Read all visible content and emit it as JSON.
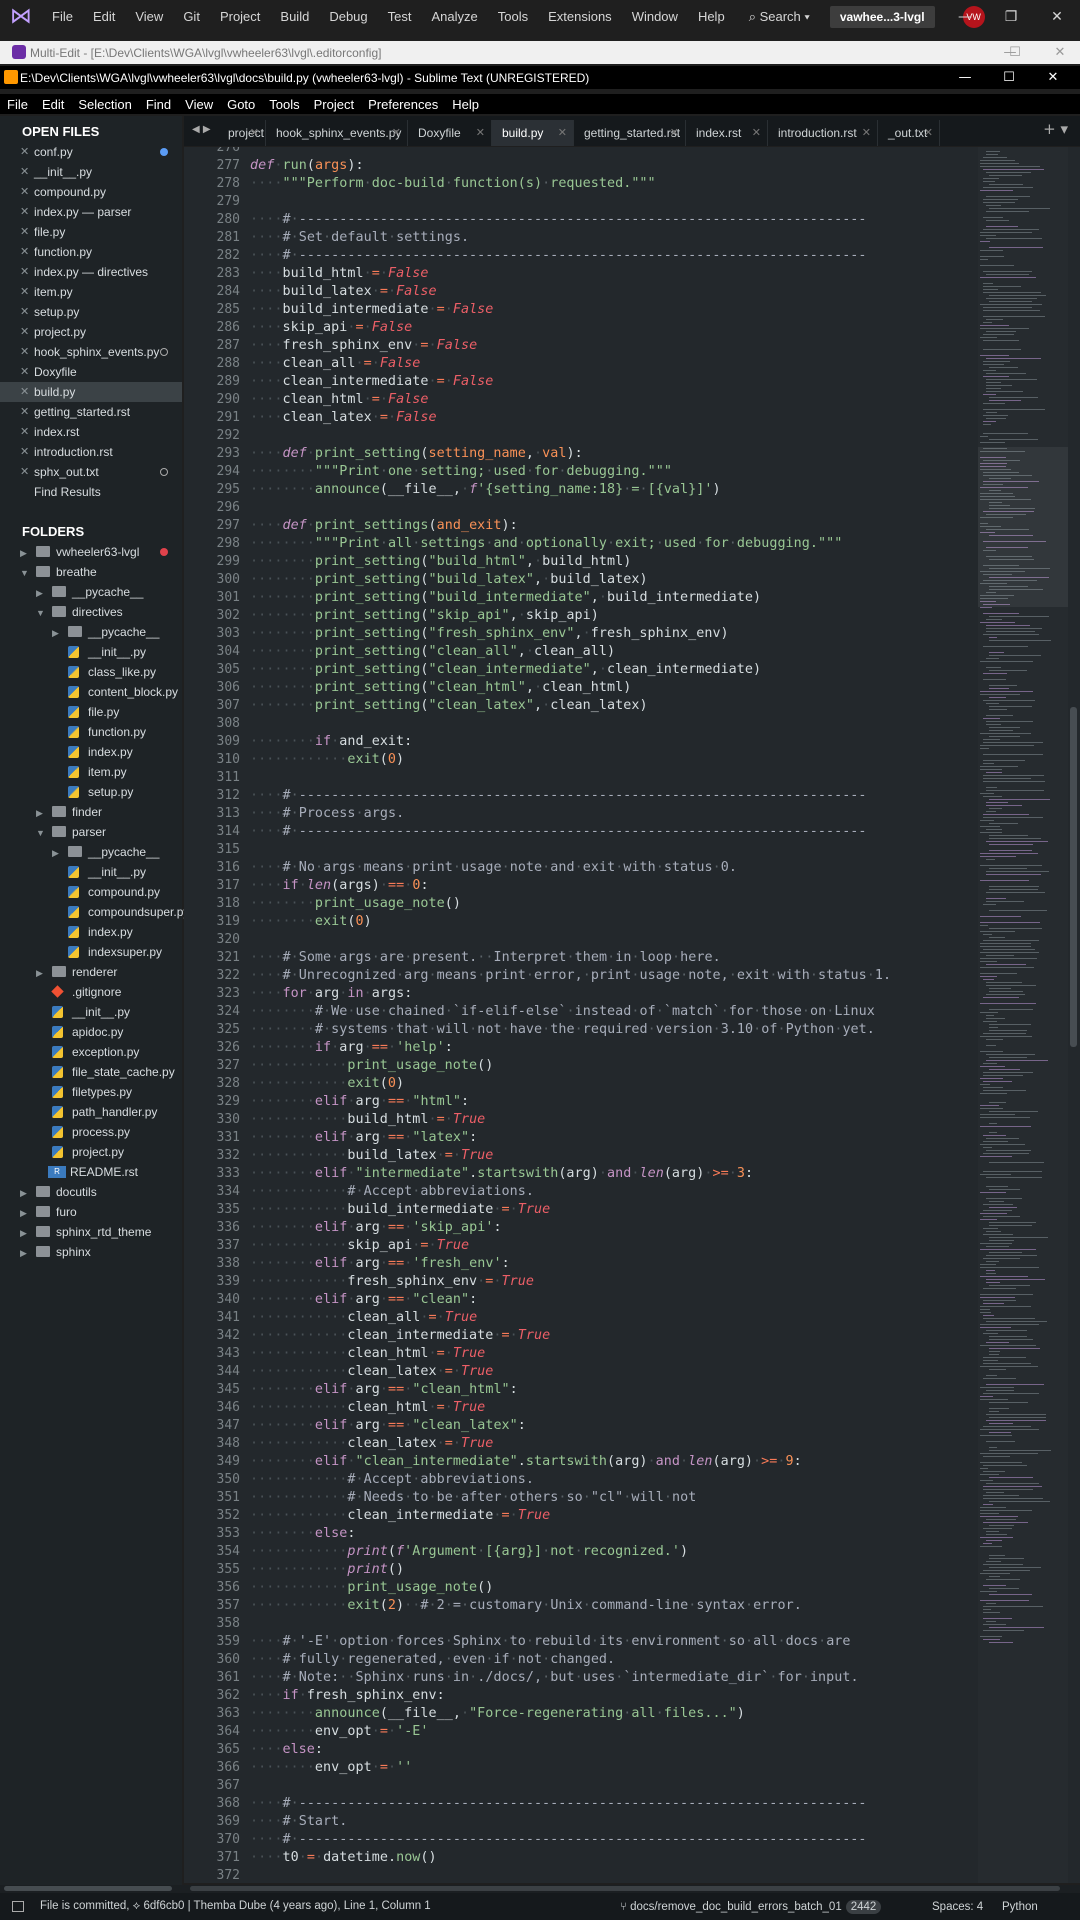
{
  "vs": {
    "menu": [
      "File",
      "Edit",
      "View",
      "Git",
      "Project",
      "Build",
      "Debug",
      "Test",
      "Analyze",
      "Tools",
      "Extensions",
      "Window",
      "Help"
    ],
    "search": "Search",
    "project": "vawhee...3-lvgl",
    "avatar": "VW"
  },
  "multiedit": {
    "title": "Multi-Edit - [E:\\Dev\\Clients\\WGA\\lvgl\\vwheeler63\\lvgl\\.editorconfig]"
  },
  "sublime": {
    "title": "E:\\Dev\\Clients\\WGA\\lvgl\\vwheeler63\\lvgl\\docs\\build.py (vwheeler63-lvgl) - Sublime Text (UNREGISTERED)",
    "menu": [
      "File",
      "Edit",
      "Selection",
      "Find",
      "View",
      "Goto",
      "Tools",
      "Project",
      "Preferences",
      "Help"
    ]
  },
  "sidebar": {
    "open_files_title": "OPEN FILES",
    "folders_title": "FOLDERS",
    "open_files": [
      "conf.py",
      "__init__.py",
      "compound.py",
      "index.py — parser",
      "file.py",
      "function.py",
      "index.py — directives",
      "item.py",
      "setup.py",
      "project.py",
      "hook_sphinx_events.py",
      "Doxyfile",
      "build.py",
      "getting_started.rst",
      "index.rst",
      "introduction.rst",
      "sphx_out.txt",
      "Find Results"
    ],
    "folders": [
      "vwheeler63-lvgl",
      "breathe",
      "__pycache__",
      "directives",
      "__pycache__",
      "__init__.py",
      "class_like.py",
      "content_block.py",
      "file.py",
      "function.py",
      "index.py",
      "item.py",
      "setup.py",
      "finder",
      "parser",
      "__pycache__",
      "__init__.py",
      "compound.py",
      "compoundsuper.py",
      "index.py",
      "indexsuper.py",
      "renderer",
      ".gitignore",
      "__init__.py",
      "apidoc.py",
      "exception.py",
      "file_state_cache.py",
      "filetypes.py",
      "path_handler.py",
      "process.py",
      "project.py",
      "README.rst",
      "docutils",
      "furo",
      "sphinx_rtd_theme",
      "sphinx"
    ]
  },
  "tabs": [
    "project.",
    "hook_sphinx_events.py",
    "Doxyfile",
    "build.py",
    "getting_started.rst",
    "index.rst",
    "introduction.rst",
    "_out.txt"
  ],
  "code": {
    "first_line": 276,
    "lines": [
      "",
      "def run(args):",
      "    \"\"\"Perform doc-build function(s) requested.\"\"\"",
      "",
      "    # ----------------------------------------------------------------------",
      "    # Set default settings.",
      "    # ----------------------------------------------------------------------",
      "    build_html = False",
      "    build_latex = False",
      "    build_intermediate = False",
      "    skip_api = False",
      "    fresh_sphinx_env = False",
      "    clean_all = False",
      "    clean_intermediate = False",
      "    clean_html = False",
      "    clean_latex = False",
      "",
      "    def print_setting(setting_name, val):",
      "        \"\"\"Print one setting; used for debugging.\"\"\"",
      "        announce(__file__, f'{setting_name:18} = [{val}]')",
      "",
      "    def print_settings(and_exit):",
      "        \"\"\"Print all settings and optionally exit; used for debugging.\"\"\"",
      "        print_setting(\"build_html\", build_html)",
      "        print_setting(\"build_latex\", build_latex)",
      "        print_setting(\"build_intermediate\", build_intermediate)",
      "        print_setting(\"skip_api\", skip_api)",
      "        print_setting(\"fresh_sphinx_env\", fresh_sphinx_env)",
      "        print_setting(\"clean_all\", clean_all)",
      "        print_setting(\"clean_intermediate\", clean_intermediate)",
      "        print_setting(\"clean_html\", clean_html)",
      "        print_setting(\"clean_latex\", clean_latex)",
      "",
      "        if and_exit:",
      "            exit(0)",
      "",
      "    # ----------------------------------------------------------------------",
      "    # Process args.",
      "    # ----------------------------------------------------------------------",
      "",
      "    # No args means print usage note and exit with status 0.",
      "    if len(args) == 0:",
      "        print_usage_note()",
      "        exit(0)",
      "",
      "    # Some args are present.  Interpret them in loop here.",
      "    # Unrecognized arg means print error, print usage note, exit with status 1.",
      "    for arg in args:",
      "        # We use chained `if-elif-else` instead of `match` for those on Linux",
      "        # systems that will not have the required version 3.10 of Python yet.",
      "        if arg == 'help':",
      "            print_usage_note()",
      "            exit(0)",
      "        elif arg == \"html\":",
      "            build_html = True",
      "        elif arg == \"latex\":",
      "            build_latex = True",
      "        elif \"intermediate\".startswith(arg) and len(arg) >= 3:",
      "            # Accept abbreviations.",
      "            build_intermediate = True",
      "        elif arg == 'skip_api':",
      "            skip_api = True",
      "        elif arg == 'fresh_env':",
      "            fresh_sphinx_env = True",
      "        elif arg == \"clean\":",
      "            clean_all = True",
      "            clean_intermediate = True",
      "            clean_html = True",
      "            clean_latex = True",
      "        elif arg == \"clean_html\":",
      "            clean_html = True",
      "        elif arg == \"clean_latex\":",
      "            clean_latex = True",
      "        elif \"clean_intermediate\".startswith(arg) and len(arg) >= 9:",
      "            # Accept abbreviations.",
      "            # Needs to be after others so \"cl\" will not",
      "            clean_intermediate = True",
      "        else:",
      "            print(f'Argument [{arg}] not recognized.')",
      "            print()",
      "            print_usage_note()",
      "            exit(2)  # 2 = customary Unix command-line syntax error.",
      "",
      "    # '-E' option forces Sphinx to rebuild its environment so all docs are",
      "    # fully regenerated, even if not changed.",
      "    # Note:  Sphinx runs in ./docs/, but uses `intermediate_dir` for input.",
      "    if fresh_sphinx_env:",
      "        announce(__file__, \"Force-regenerating all files...\")",
      "        env_opt = '-E'",
      "    else:",
      "        env_opt = ''",
      "",
      "    # ----------------------------------------------------------------------",
      "    # Start.",
      "    # ----------------------------------------------------------------------",
      "    t0 = datetime.now()",
      ""
    ]
  },
  "status": {
    "message": "File is committed, ⟡ 6df6cb0 | Themba Dube (4 years ago), Line 1, Column 1",
    "branch": "docs/remove_doc_build_errors_batch_01",
    "count": "2442",
    "spaces": "Spaces: 4",
    "language": "Python"
  },
  "colors": {
    "keyword": "#c594c5",
    "func": "#99c794",
    "string": "#99c794",
    "bool": "#ec5f67",
    "number": "#f99157",
    "param": "#f99157",
    "comment": "#a7adba",
    "operator": "#f97b58"
  }
}
